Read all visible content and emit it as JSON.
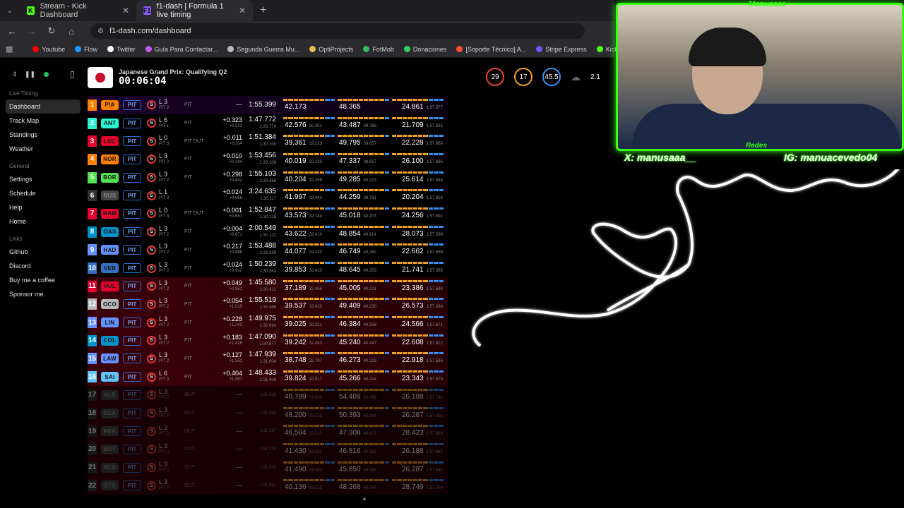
{
  "tabs": [
    {
      "label": "Stream - Kick Dashboard",
      "favicon": "K",
      "color": "#53fc18",
      "active": false
    },
    {
      "label": "f1-dash | Formula 1 live timing",
      "favicon": "F1",
      "color": "#8a5cf6",
      "active": true
    }
  ],
  "url": "f1-dash.com/dashboard",
  "bookmarks": [
    {
      "label": "Youtube",
      "color": "#ff0000"
    },
    {
      "label": "Flow",
      "color": "#1f9aff"
    },
    {
      "label": "Twitter",
      "color": "#ffffff"
    },
    {
      "label": "Guía Para Contactar...",
      "color": "#c058f0"
    },
    {
      "label": "Segunda Guerra Mu...",
      "color": "#bbbbbb"
    },
    {
      "label": "OptiProjects",
      "color": "#e0c050"
    },
    {
      "label": "FotMob",
      "color": "#2fbf5f"
    },
    {
      "label": "Donaciones",
      "color": "#30d060"
    },
    {
      "label": "[Soporte Técnico] A...",
      "color": "#ff5030"
    },
    {
      "label": "Stripe Express",
      "color": "#6a5af9"
    },
    {
      "label": "Kick Dashboard",
      "color": "#53fc18"
    }
  ],
  "sidebar": {
    "top_number": "4",
    "sections": [
      {
        "title": "Live Timing",
        "items": [
          "Dashboard",
          "Track Map",
          "Standings",
          "Weather"
        ]
      },
      {
        "title": "General",
        "items": [
          "Settings",
          "Schedule",
          "Help",
          "Home"
        ]
      },
      {
        "title": "Links",
        "items": [
          "Github",
          "Discord",
          "Buy me a coffee",
          "Sponsor me"
        ]
      }
    ],
    "active": "Dashboard"
  },
  "session": {
    "title": "Japanese Grand Prix: Qualifying Q2",
    "clock": "00:06:04"
  },
  "weather": [
    {
      "value": "29",
      "color": "#e8442a"
    },
    {
      "value": "17",
      "color": "#f0a020"
    },
    {
      "value": "45.5",
      "color": "#3a8ef0"
    }
  ],
  "weather_extra": "2.1",
  "drivers": [
    {
      "pos": "1",
      "tla": "PIA",
      "team": "#ff8000",
      "tyre": "S",
      "lap": "L 3",
      "lapsub": "PIT 2",
      "status": "PIT",
      "gap": "---",
      "gapsub": "",
      "time": "1:55.399",
      "timesub": "",
      "s1": "42.173",
      "s1b": "",
      "s2": "48.365",
      "s2b": "",
      "s3": "24.861",
      "s3b": "1:57.577",
      "style": "purple"
    },
    {
      "pos": "2",
      "tla": "ANT",
      "team": "#27f4d2",
      "tyre": "S",
      "lap": "L 6",
      "lapsub": "PIT 1",
      "status": "PIT",
      "gap": "+0.323",
      "gapsub": "+0.323",
      "time": "1:47.772",
      "timesub": "1:29.774",
      "s1": "42.576",
      "s1b": "32.351",
      "s2": "43.487",
      "s2b": "39.788",
      "s3": "21.709",
      "s3b": "1:57.835",
      "style": ""
    },
    {
      "pos": "3",
      "tla": "LEC",
      "team": "#e8002d",
      "tyre": "S",
      "lap": "L 0",
      "lapsub": "PIT 3",
      "status": "PIT OUT",
      "gap": "+0.011",
      "gapsub": "+0.334",
      "time": "1:51.384",
      "timesub": "1:30.109",
      "s1": "39.361",
      "s1b": "32.223",
      "s2": "49.795",
      "s2b": "39.857",
      "s3": "22.228",
      "s3b": "1:57.668",
      "style": ""
    },
    {
      "pos": "4",
      "tla": "NOR",
      "team": "#ff8000",
      "tyre": "S",
      "lap": "L 3",
      "lapsub": "PIT 2",
      "status": "PIT",
      "gap": "+0.010",
      "gapsub": "+0.344",
      "time": "1:53.456",
      "timesub": "1:30.108",
      "s1": "40.019",
      "s1b": "32.233",
      "s2": "47.337",
      "s2b": "39.857",
      "s3": "26.100",
      "s3b": "1:57.695",
      "style": ""
    },
    {
      "pos": "5",
      "tla": "BOR",
      "team": "#52e252",
      "tyre": "S",
      "lap": "L 3",
      "lapsub": "PIT 2",
      "status": "PIT",
      "gap": "+0.298",
      "gapsub": "+0.642",
      "time": "1:55.103",
      "timesub": "1:30.456",
      "s1": "40.204",
      "s1b": "32.269",
      "s2": "49.285",
      "s2b": "40.213",
      "s3": "25.614",
      "s3b": "1:57.584",
      "style": ""
    },
    {
      "pos": "6",
      "tla": "RUS",
      "team": "#27f4d2",
      "tyre": "S",
      "lap": "L 1",
      "lapsub": "PIT 3",
      "status": "",
      "gap": "+0.024",
      "gapsub": "+0.666",
      "time": "3:24.635",
      "timesub": "1:30.117",
      "s1": "41.997",
      "s1b": "32.443",
      "s2": "44.259",
      "s2b": "39.791",
      "s3": "20.204",
      "s3b": "1:57.654",
      "style": "dimrow"
    },
    {
      "pos": "7",
      "tla": "HAM",
      "team": "#e8002d",
      "tyre": "S",
      "lap": "L 0",
      "lapsub": "PIT 3",
      "status": "PIT OUT",
      "gap": "+0.001",
      "gapsub": "+0.667",
      "time": "1:52.847",
      "timesub": "1:30.118",
      "s1": "43.573",
      "s1b": "32.144",
      "s2": "45.018",
      "s2b": "40.203",
      "s3": "24.256",
      "s3b": "1:57.691",
      "style": ""
    },
    {
      "pos": "8",
      "tla": "GAS",
      "team": "#0093cc",
      "tyre": "S",
      "lap": "L 3",
      "lapsub": "PIT 2",
      "status": "PIT",
      "gap": "+0.004",
      "gapsub": "+0.671",
      "time": "2:00.549",
      "timesub": "1:30.122",
      "s1": "43.622",
      "s1b": "32.410",
      "s2": "48.854",
      "s2b": "40.114",
      "s3": "28.073",
      "s3b": "1:57.598",
      "style": ""
    },
    {
      "pos": "9",
      "tla": "HAD",
      "team": "#6692ff",
      "tyre": "S",
      "lap": "L 3",
      "lapsub": "PIT 2",
      "status": "PIT",
      "gap": "+0.217",
      "gapsub": "+0.888",
      "time": "1:53.488",
      "timesub": "1:30.339",
      "s1": "44.077",
      "s1b": "32.233",
      "s2": "46.749",
      "s2b": "40.262",
      "s3": "22.662",
      "s3b": "1:57.658",
      "style": ""
    },
    {
      "pos": "10",
      "tla": "VER",
      "team": "#3671c6",
      "tyre": "S",
      "lap": "L 3",
      "lapsub": "PIT 2",
      "status": "PIT",
      "gap": "+0.024",
      "gapsub": "+0.912",
      "time": "1:50.239",
      "timesub": "1:30.363",
      "s1": "39.853",
      "s1b": "32.423",
      "s2": "48.645",
      "s2b": "40.253",
      "s3": "21.741",
      "s3b": "1:57.565",
      "style": ""
    },
    {
      "pos": "11",
      "tla": "HUL",
      "team": "#e8002d",
      "tyre": "S",
      "lap": "L 3",
      "lapsub": "PIT 2",
      "status": "PIT",
      "gap": "+0.049",
      "gapsub": "+0.961",
      "time": "1:45.580",
      "timesub": "1:30.412",
      "s1": "37.189",
      "s1b": "32.455",
      "s2": "45.005",
      "s2b": "40.231",
      "s3": "23.386",
      "s3b": "1:57.684",
      "style": "red"
    },
    {
      "pos": "12",
      "tla": "OCO",
      "team": "#b6babd",
      "tyre": "S",
      "lap": "L 3",
      "lapsub": "PIT 2",
      "status": "PIT",
      "gap": "+0.054",
      "gapsub": "+1.015",
      "time": "1:55.519",
      "timesub": "1:30.466",
      "s1": "39.537",
      "s1b": "32.423",
      "s2": "49.409",
      "s2b": "40.230",
      "s3": "26.573",
      "s3b": "1:57.688",
      "style": "red"
    },
    {
      "pos": "13",
      "tla": "LIN",
      "team": "#6692ff",
      "tyre": "S",
      "lap": "L 3",
      "lapsub": "PIT 2",
      "status": "PIT",
      "gap": "+0.228",
      "gapsub": "+1.243",
      "time": "1:49.975",
      "timesub": "1:30.694",
      "s1": "39.025",
      "s1b": "32.251",
      "s2": "46.384",
      "s2b": "40.256",
      "s3": "24.566",
      "s3b": "1:57.671",
      "style": "red"
    },
    {
      "pos": "14",
      "tla": "COL",
      "team": "#0093cc",
      "tyre": "S",
      "lap": "L 3",
      "lapsub": "PIT 2",
      "status": "PIT",
      "gap": "+0.183",
      "gapsub": "+1.426",
      "time": "1:47.090",
      "timesub": "1:30.877",
      "s1": "39.242",
      "s1b": "32.463",
      "s2": "45.240",
      "s2b": "40.447",
      "s3": "22.608",
      "s3b": "1:57.812",
      "style": "red"
    },
    {
      "pos": "15",
      "tla": "LAW",
      "team": "#6692ff",
      "tyre": "S",
      "lap": "L 3",
      "lapsub": "PIT 2",
      "status": "PIT",
      "gap": "+0.127",
      "gapsub": "+1.553",
      "time": "1:47.939",
      "timesub": "1:31.004",
      "s1": "38.748",
      "s1b": "32.797",
      "s2": "46.273",
      "s2b": "40.233",
      "s3": "22.918",
      "s3b": "1:57.586",
      "style": "red"
    },
    {
      "pos": "16",
      "tla": "SAI",
      "team": "#64c4ff",
      "tyre": "S",
      "lap": "L 6",
      "lapsub": "PIT 3",
      "status": "PIT",
      "gap": "+0.404",
      "gapsub": "+1.957",
      "time": "1:48.433",
      "timesub": "1:31.408",
      "s1": "39.824",
      "s1b": "32.917",
      "s2": "45.266",
      "s2b": "40.434",
      "s3": "23.343",
      "s3b": "1:57.578",
      "style": "red"
    },
    {
      "pos": "17",
      "tla": "ALB",
      "team": "#64c4ff",
      "tyre": "S",
      "lap": "L 3",
      "lapsub": "PIT 2",
      "status": "OUT",
      "gap": "---",
      "gapsub": "",
      "time": "",
      "timesub": "1:31.088",
      "s1": "40.789",
      "s1b": "32.693",
      "s2": "54.409",
      "s2b": "40.489",
      "s3": "26.188",
      "s3b": "1:57.741",
      "style": "red dim"
    },
    {
      "pos": "18",
      "tla": "BEA",
      "team": "#b6babd",
      "tyre": "S",
      "lap": "L 3",
      "lapsub": "PIT 2",
      "status": "OUT",
      "gap": "---",
      "gapsub": "",
      "time": "",
      "timesub": "1:31.090",
      "s1": "48.200",
      "s1b": "32.522",
      "s2": "50.393",
      "s2b": "40.381",
      "s3": "26.287",
      "s3b": "1:57.695",
      "style": "red dim"
    },
    {
      "pos": "19",
      "tla": "PER",
      "team": "#3671c6",
      "tyre": "S",
      "lap": "L 3",
      "lapsub": "PIT 2",
      "status": "OUT",
      "gap": "---",
      "gapsub": "",
      "time": "",
      "timesub": "1:31.387",
      "s1": "46.504",
      "s1b": "32.513",
      "s2": "47.308",
      "s2b": "40.473",
      "s3": "28.423",
      "s3b": "1:57.868",
      "style": "red dim"
    },
    {
      "pos": "20",
      "tla": "BOT",
      "team": "#52e252",
      "tyre": "S",
      "lap": "L 3",
      "lapsub": "PIT 2",
      "status": "OUT",
      "gap": "---",
      "gapsub": "",
      "time": "",
      "timesub": "1:31.470",
      "s1": "41.430",
      "s1b": "33.262",
      "s2": "46.816",
      "s2b": "40.361",
      "s3": "26.188",
      "s3b": "1:57.862",
      "style": "red dim"
    },
    {
      "pos": "21",
      "tla": "ALO",
      "team": "#229971",
      "tyre": "S",
      "lap": "L 3",
      "lapsub": "PIT 2",
      "status": "OUT",
      "gap": "---",
      "gapsub": "",
      "time": "",
      "timesub": "1:31.646",
      "s1": "41.490",
      "s1b": "33.163",
      "s2": "45.850",
      "s2b": "40.588",
      "s3": "26.287",
      "s3b": "1:57.662",
      "style": "red dim"
    },
    {
      "pos": "22",
      "tla": "STR",
      "team": "#229971",
      "tyre": "S",
      "lap": "L 3",
      "lapsub": "PIT 2",
      "status": "OUT",
      "gap": "---",
      "gapsub": "",
      "time": "",
      "timesub": "1:31.861",
      "s1": "40.136",
      "s1b": "33.128",
      "s2": "48.268",
      "s2b": "40.341",
      "s3": "28.749",
      "s3b": "1:57.754",
      "style": "red dim"
    }
  ],
  "webcam": {
    "name": "Manusaaa",
    "redes": "Redes",
    "x": "X: manusaaa__",
    "ig": "IG: manuacevedo04"
  }
}
